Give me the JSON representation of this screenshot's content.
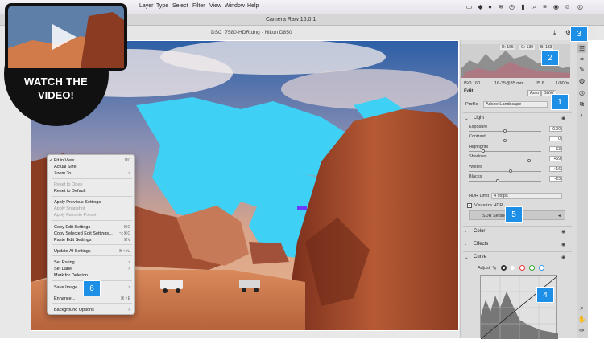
{
  "menubar": {
    "items": [
      "Layer",
      "Type",
      "Select",
      "Filter",
      "View",
      "Window",
      "Help"
    ]
  },
  "window": {
    "title": "Camera Raw 16.0.1",
    "filename": "DSC_7580-HDR.dng  ·  Nikon D850"
  },
  "histogram": {
    "rgb_r": "R: 165",
    "rgb_g": "G: 139",
    "rgb_b": "B: 133"
  },
  "exif": {
    "iso": "ISO 160",
    "lens": "16-35@35 mm",
    "aperture": "f/5.6",
    "shutter": "1/800s"
  },
  "edit": {
    "heading": "Edit",
    "auto": "Auto",
    "bw": "B&W",
    "profile_label": "Profile",
    "profile_value": "Adobe Landscape"
  },
  "light": {
    "heading": "Light",
    "sliders": [
      {
        "label": "Exposure",
        "value": "0.00",
        "pos": 0.5
      },
      {
        "label": "Contrast",
        "value": "0",
        "pos": 0.5
      },
      {
        "label": "Highlights",
        "value": "-63",
        "pos": 0.19
      },
      {
        "label": "Shadows",
        "value": "+69",
        "pos": 0.85
      },
      {
        "label": "Whites",
        "value": "+16",
        "pos": 0.58
      },
      {
        "label": "Blacks",
        "value": "-23",
        "pos": 0.39
      }
    ],
    "hdr_limit_label": "HDR Limit",
    "hdr_limit_value": "4 stops",
    "visualize_hdr": "Visualize HDR",
    "sdr_settings": "SDR Settings"
  },
  "sections": {
    "color": "Color",
    "effects": "Effects",
    "curve": "Curve",
    "adjust": "Adjust"
  },
  "context_menu": {
    "items": [
      {
        "label": "Fit in View",
        "shortcut": "⌘0",
        "disabled": false,
        "check": true
      },
      {
        "label": "Actual Size",
        "shortcut": "",
        "disabled": false
      },
      {
        "label": "Zoom To",
        "shortcut": ">",
        "disabled": false
      },
      {
        "label": "Reset to Open",
        "shortcut": "",
        "disabled": true
      },
      {
        "label": "Reset to Default",
        "shortcut": "",
        "disabled": false
      },
      {
        "label": "Apply Previous Settings",
        "shortcut": "",
        "disabled": false
      },
      {
        "label": "Apply Snapshot",
        "shortcut": "",
        "disabled": true
      },
      {
        "label": "Apply Favorite Preset",
        "shortcut": "",
        "disabled": true
      },
      {
        "label": "Copy Edit Settings",
        "shortcut": "⌘C",
        "disabled": false
      },
      {
        "label": "Copy Selected Edit Settings...",
        "shortcut": "⌥⌘C",
        "disabled": false
      },
      {
        "label": "Paste Edit Settings",
        "shortcut": "⌘V",
        "disabled": false
      },
      {
        "label": "Update AI Settings",
        "shortcut": "⌘⌥U",
        "disabled": false
      },
      {
        "label": "Set Rating",
        "shortcut": ">",
        "disabled": false
      },
      {
        "label": "Set Label",
        "shortcut": ">",
        "disabled": false
      },
      {
        "label": "Mark for Deletion",
        "shortcut": "",
        "disabled": false
      },
      {
        "label": "Save Image",
        "shortcut": ">",
        "disabled": false
      },
      {
        "label": "Enhance...",
        "shortcut": "⌘⇧E",
        "disabled": false
      },
      {
        "label": "Background Options",
        "shortcut": ">",
        "disabled": false
      }
    ]
  },
  "callouts": [
    "1",
    "2",
    "3",
    "4",
    "5",
    "6"
  ],
  "video_badge": {
    "line1": "WATCH THE",
    "line2": "VIDEO!"
  },
  "colors": {
    "callout": "#1d8fe6",
    "overexposure": "#3fd0f5",
    "sky_top": "#2d5fa6",
    "rock": "#a84f2e"
  }
}
